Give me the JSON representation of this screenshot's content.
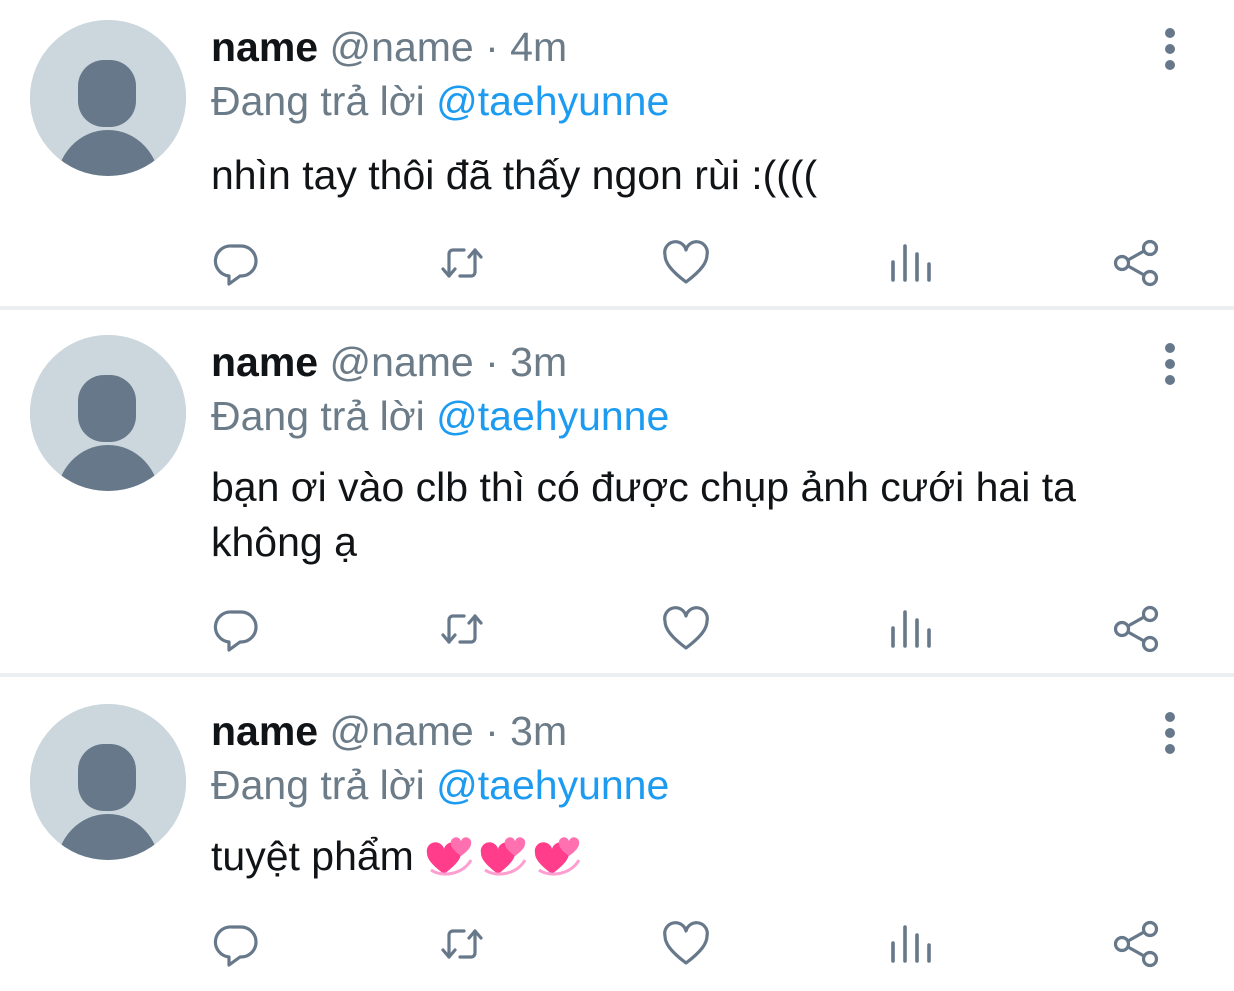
{
  "tweets": [
    {
      "name": "name",
      "handle": "@name",
      "separator": "·",
      "time": "4m",
      "reply_prefix": "Đang trả lời",
      "reply_to": "@taehyunne",
      "text": "nhìn tay thôi đã thấy ngon rùi :(((("
    },
    {
      "name": "name",
      "handle": "@name",
      "separator": "·",
      "time": "3m",
      "reply_prefix": "Đang trả lời",
      "reply_to": "@taehyunne",
      "text": "bạn ơi vào clb thì có được chụp ảnh cưới hai ta không ạ"
    },
    {
      "name": "name",
      "handle": "@name",
      "separator": "·",
      "time": "3m",
      "reply_prefix": "Đang trả lời",
      "reply_to": "@taehyunne",
      "text": "tuyệt phẩm",
      "emojis": [
        "revolving-hearts",
        "revolving-hearts",
        "revolving-hearts"
      ]
    }
  ],
  "icons": {
    "actions": [
      "reply-icon",
      "retweet-icon",
      "like-icon",
      "analytics-icon",
      "share-icon"
    ],
    "more": "more-options-icon"
  },
  "colors": {
    "text": "#111417",
    "secondary": "#6b7b87",
    "mention": "#1d9bf0",
    "avatar_bg": "#ccd6dd",
    "avatar_fg": "#66788a",
    "divider": "#eceff1"
  }
}
